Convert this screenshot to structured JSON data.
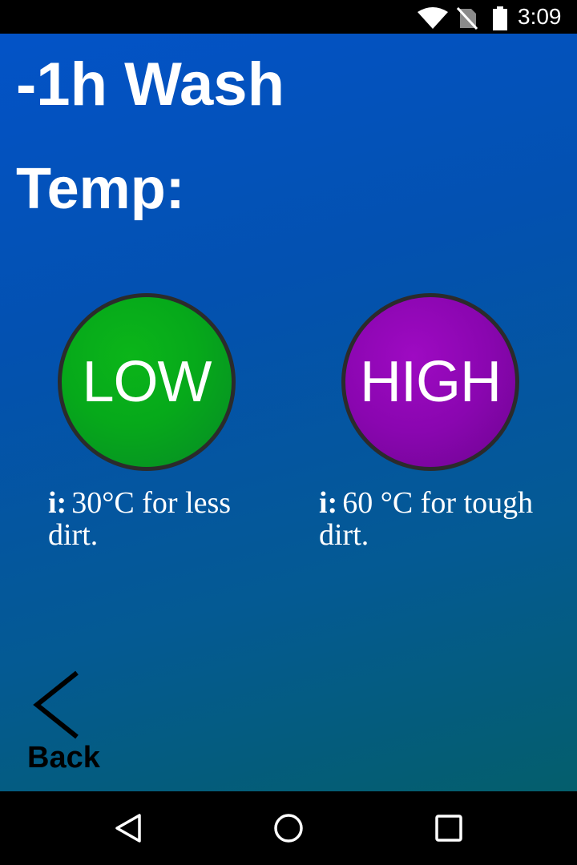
{
  "status_bar": {
    "time": "3:09",
    "icons": [
      "wifi-icon",
      "no-sim-icon",
      "battery-icon"
    ]
  },
  "screen": {
    "title": "-1h Wash",
    "section_label": "Temp:",
    "options": [
      {
        "label": "LOW",
        "info_prefix": "i:",
        "info_text": "30°C for less dirt.",
        "color": "#06a91a"
      },
      {
        "label": "HIGH",
        "info_prefix": "i:",
        "info_text": "60 °C for tough dirt.",
        "color": "#8a06b0"
      }
    ],
    "back_label": "Back"
  },
  "nav_bar": {
    "buttons": [
      "back-triangle-icon",
      "home-circle-icon",
      "recents-square-icon"
    ]
  },
  "colors": {
    "background_top": "#0353c7",
    "background_bottom": "#045e6c"
  }
}
